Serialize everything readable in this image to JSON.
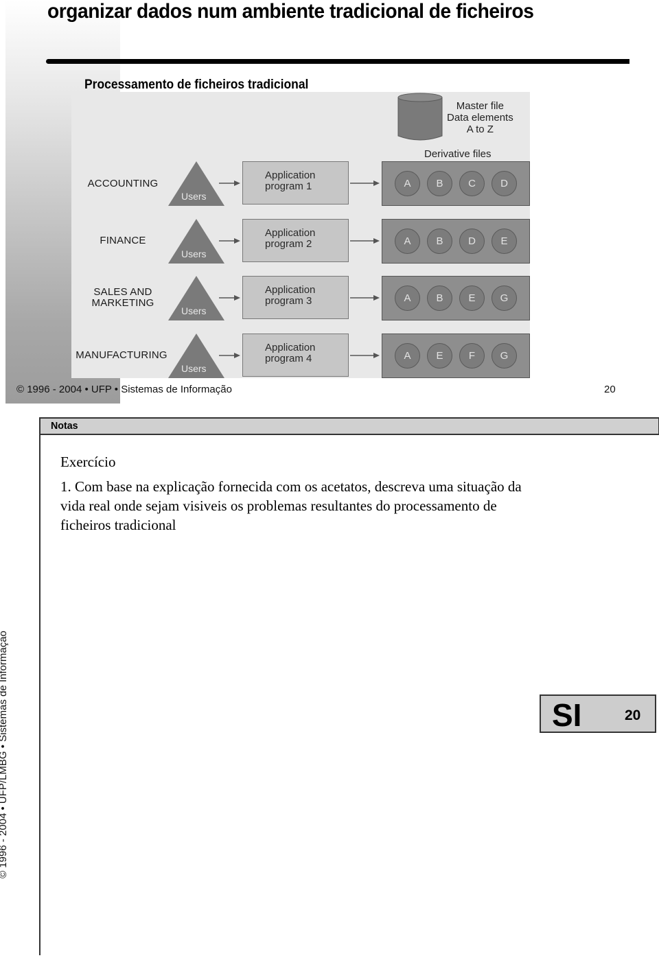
{
  "slide": {
    "title": "organizar dados num ambiente tradicional de ficheiros",
    "diagram_caption": "Processamento de ficheiros tradicional",
    "diagram": {
      "master_file": [
        "Master file",
        "Data elements",
        "A to Z"
      ],
      "derivative_label": "Derivative files",
      "users_label": "Users",
      "rows": [
        {
          "department": "ACCOUNTING",
          "program": [
            "Application",
            "program 1"
          ],
          "files": [
            "A",
            "B",
            "C",
            "D"
          ]
        },
        {
          "department": "FINANCE",
          "program": [
            "Application",
            "program 2"
          ],
          "files": [
            "A",
            "B",
            "D",
            "E"
          ]
        },
        {
          "department": "SALES AND MARKETING",
          "department_lines": [
            "SALES AND",
            "MARKETING"
          ],
          "program": [
            "Application",
            "program 3"
          ],
          "files": [
            "A",
            "B",
            "E",
            "G"
          ]
        },
        {
          "department": "MANUFACTURING",
          "program": [
            "Application",
            "program 4"
          ],
          "files": [
            "A",
            "E",
            "F",
            "G"
          ]
        }
      ]
    },
    "footer": "© 1996 - 2004 • UFP • Sistemas de Informação",
    "page_number": "20"
  },
  "notes": {
    "header": "Notas",
    "exercise_title": "Exercício",
    "exercise_text": "1. Com base na explicação fornecida com os acetatos, descreva uma situação da vida real onde sejam visiveis os problemas resultantes do processamento de ficheiros tradicional"
  },
  "side_text": "© 1996 - 2004 • UFP/LMBG • Sistemas de Informação",
  "badge": {
    "label": "SI",
    "page_number": "20"
  }
}
